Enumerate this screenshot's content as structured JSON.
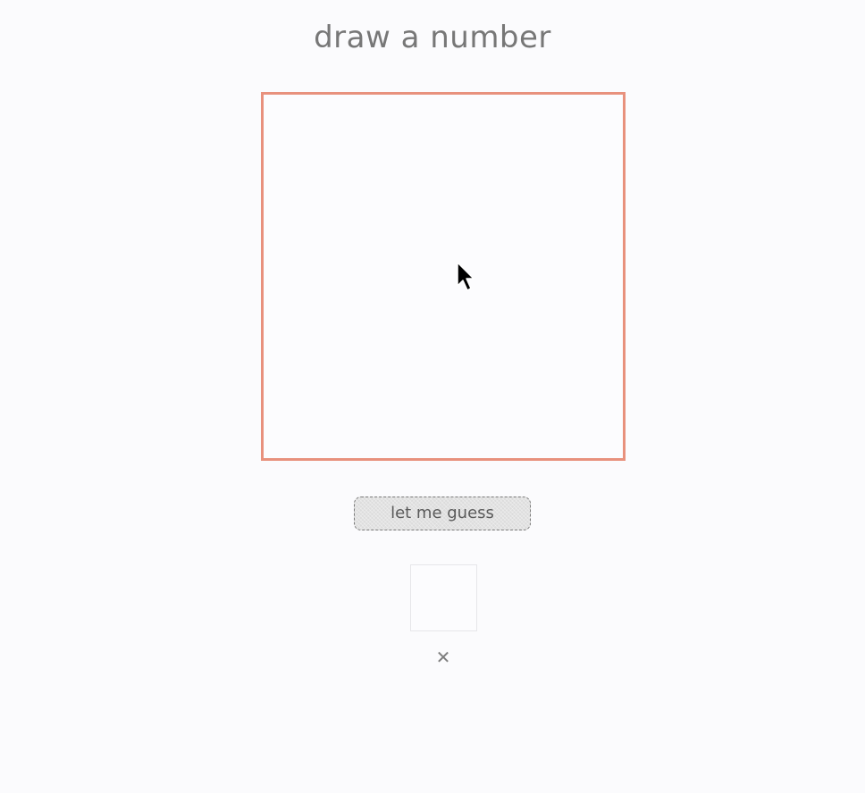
{
  "header": {
    "title": "draw a number"
  },
  "drawing_canvas": {
    "border_color": "#e8917d"
  },
  "actions": {
    "guess_label": "let me guess"
  },
  "result": {
    "mark_icon": "close-icon",
    "mark_glyph": "✕"
  }
}
